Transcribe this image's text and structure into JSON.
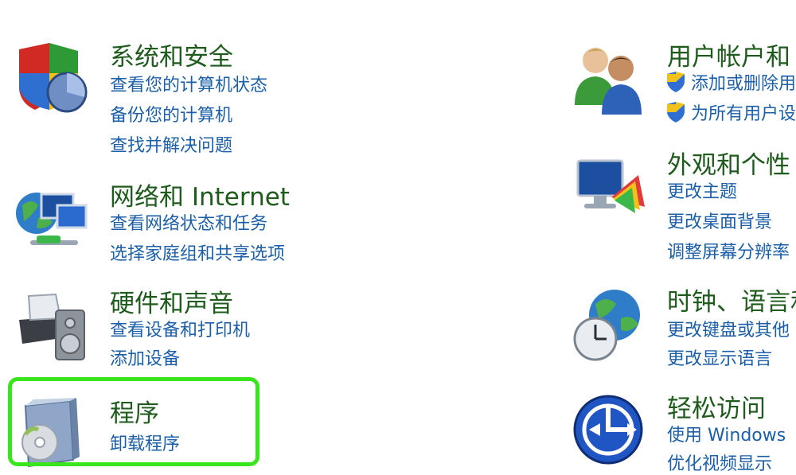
{
  "left_column": [
    {
      "icon": "shield-security-icon",
      "title": "系统和安全",
      "links": [
        "查看您的计算机状态",
        "备份您的计算机",
        "查找并解决问题"
      ]
    },
    {
      "icon": "network-globe-icon",
      "title": "网络和 Internet",
      "links": [
        "查看网络状态和任务",
        "选择家庭组和共享选项"
      ]
    },
    {
      "icon": "printer-speaker-icon",
      "title": "硬件和声音",
      "links": [
        "查看设备和打印机",
        "添加设备"
      ]
    },
    {
      "icon": "programs-box-icon",
      "title": "程序",
      "links": [
        "卸载程序"
      ]
    }
  ],
  "right_column": [
    {
      "icon": "users-icon",
      "title": "用户帐户和",
      "links": [
        "添加或删除用",
        "为所有用户设"
      ]
    },
    {
      "icon": "appearance-monitor-icon",
      "title": "外观和个性",
      "links": [
        "更改主题",
        "更改桌面背景",
        "调整屏幕分辨率"
      ]
    },
    {
      "icon": "clock-globe-icon",
      "title": "时钟、语言和",
      "links": [
        "更改键盘或其他",
        "更改显示语言"
      ]
    },
    {
      "icon": "ease-of-access-icon",
      "title": "轻松访问",
      "links": [
        "使用 Windows",
        "优化视频显示"
      ]
    }
  ],
  "colors": {
    "title": "#1e5b1c",
    "link": "#1c5fa8",
    "highlight": "#39e61d"
  }
}
